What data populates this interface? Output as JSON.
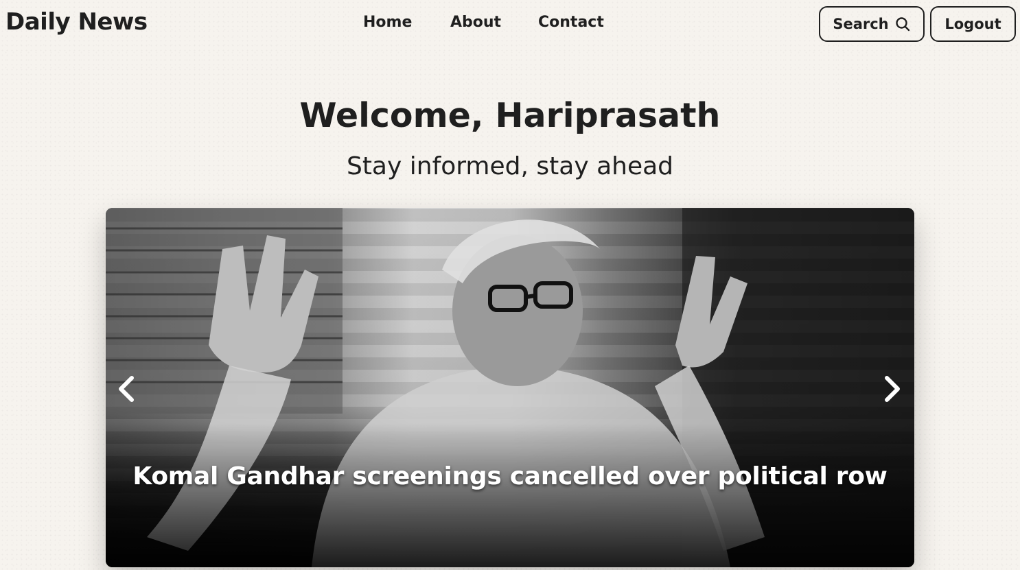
{
  "brand": {
    "name": "Daily News"
  },
  "nav": {
    "links": [
      {
        "label": "Home"
      },
      {
        "label": "About"
      },
      {
        "label": "Contact"
      }
    ],
    "search_label": "Search",
    "logout_label": "Logout"
  },
  "hero": {
    "welcome": "Welcome, Hariprasath",
    "tagline": "Stay informed, stay ahead"
  },
  "carousel": {
    "caption": "Komal Gandhar screenings cancelled over political row",
    "prev_icon": "chevron-left-icon",
    "next_icon": "chevron-right-icon"
  },
  "colors": {
    "background": "#f6f3ee",
    "text": "#1f1f1f",
    "caption": "#ffffff"
  }
}
